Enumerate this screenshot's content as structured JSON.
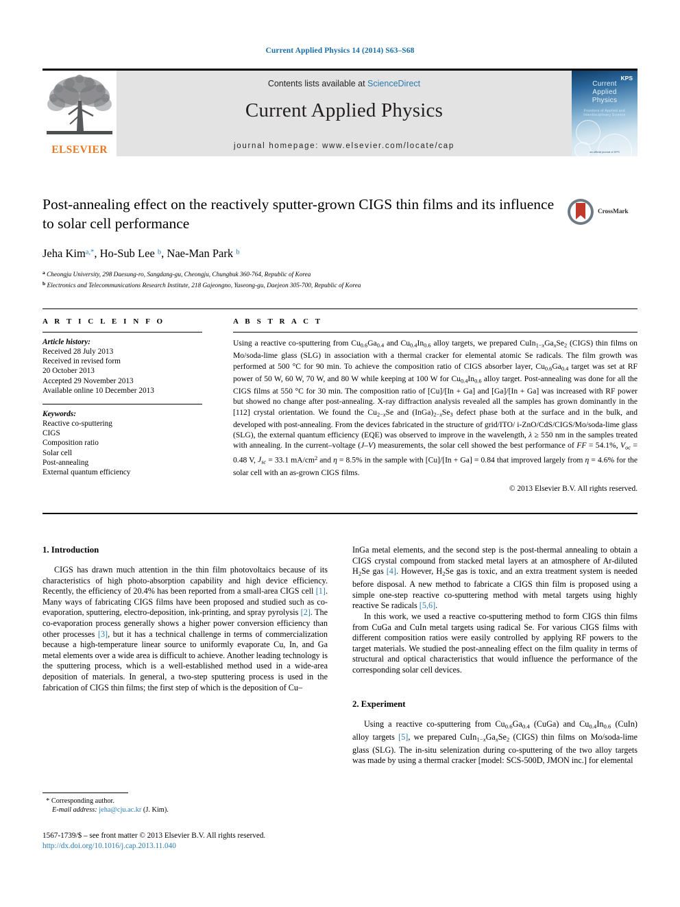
{
  "running_head": "Current Applied Physics 14 (2014) S63–S68",
  "masthead": {
    "publisher": "ELSEVIER",
    "contents_prefix": "Contents lists available at ",
    "contents_link": "ScienceDirect",
    "journal_name": "Current Applied Physics",
    "homepage": "journal homepage: www.elsevier.com/locate/cap",
    "cover": {
      "line1": "Current",
      "line2": "Applied",
      "line3": "Physics",
      "subtitle": "Frontiers of Applied and Interdisciplinary Science",
      "society": "KPS",
      "bottom": "an official journal of KPS"
    }
  },
  "article": {
    "title": "Post-annealing effect on the reactively sputter-grown CIGS thin films and its influence to solar cell performance",
    "crossmark_label": "CrossMark",
    "authors_html": "Jeha Kim<sup>a,*</sup>, Ho-Sub Lee <sup>b</sup>, Nae-Man Park <sup>b</sup>",
    "affiliation_a": "Cheongju University, 298 Daesung-ro, Sangdang-gu, Cheongju, Chungbuk 360-764, Republic of Korea",
    "affiliation_b": "Electronics and Telecommunications Research Institute, 218 Gajeongno, Yuseong-gu, Daejeon 305-700, Republic of Korea"
  },
  "article_info": {
    "heading": "A R T I C L E  I N F O",
    "history_label": "Article history:",
    "history": [
      "Received 28 July 2013",
      "Received in revised form",
      "20 October 2013",
      "Accepted 29 November 2013",
      "Available online 10 December 2013"
    ],
    "keywords_label": "Keywords:",
    "keywords": [
      "Reactive co-sputtering",
      "CIGS",
      "Composition ratio",
      "Solar cell",
      "Post-annealing",
      "External quantum efficiency"
    ]
  },
  "abstract": {
    "heading": "A B S T R A C T",
    "body_html": "Using a reactive co-sputtering from Cu<sub>0.6</sub>Ga<sub>0.4</sub> and Cu<sub>0.4</sub>In<sub>0.6</sub> alloy targets, we prepared CuIn<sub>1−<span class=\"ital\">x</span></sub>Ga<sub><span class=\"ital\">x</span></sub>Se<sub>2</sub> (CIGS) thin films on Mo/soda-lime glass (SLG) in association with a thermal cracker for elemental atomic Se radicals. The film growth was performed at 500 °C for 90 min. To achieve the composition ratio of CIGS absorber layer, Cu<sub>0.6</sub>Ga<sub>0.4</sub> target was set at RF power of 50 W, 60 W, 70 W, and 80 W while keeping at 100 W for Cu<sub>0.4</sub>In<sub>0.6</sub> alloy target. Post-annealing was done for all the CIGS films at 550 °C for 30 min. The composition ratio of [Cu]/[In + Ga] and [Ga]/[In + Ga] was increased with RF power but showed no change after post-annealing. X-ray diffraction analysis revealed all the samples has grown dominantly in the [112] crystal orientation. We found the Cu<sub>2−<span class=\"ital\">x</span></sub>Se and (InGa)<sub>2−<span class=\"ital\">x</span></sub>Se<sub>3</sub> defect phase both at the surface and in the bulk, and developed with post-annealing. From the devices fabricated in the structure of grid/ITO/ i-ZnO/CdS/CIGS/Mo/soda-lime glass (SLG), the external quantum efficiency (EQE) was observed to improve in the wavelength, <span class=\"ital\">λ</span> ≥ 550 nm in the samples treated with annealing. In the current–voltage (<span class=\"ital\">J</span>–<span class=\"ital\">V</span>) measurements, the solar cell showed the best performance of <span class=\"ital\">FF</span> = 54.1%, <span class=\"ital\">V<sub>oc</sub></span> = 0.48 V, <span class=\"ital\">J<sub>sc</sub></span> = 33.1 mA/cm<sup>2</sup> and <span class=\"ital\">η</span> = 8.5% in the sample with [Cu]/[In + Ga] = 0.84 that improved largely from <span class=\"ital\">η</span> = 4.6% for the solar cell with an as-grown CIGS films.",
    "copyright": "© 2013 Elsevier B.V. All rights reserved."
  },
  "sections": {
    "intro_heading": "1. Introduction",
    "intro_p1_html": "CIGS has drawn much attention in the thin film photovoltaics because of its characteristics of high photo-absorption capability and high device efficiency. Recently, the efficiency of 20.4% has been reported from a small-area CIGS cell <span class=\"ref\">[1]</span>. Many ways of fabricating CIGS films have been proposed and studied such as co-evaporation, sputtering, electro-deposition, ink-printing, and spray pyrolysis <span class=\"ref\">[2]</span>. The co-evaporation process generally shows a higher power conversion efficiency than other processes <span class=\"ref\">[3]</span>, but it has a technical challenge in terms of commercialization because a high-temperature linear source to uniformly evaporate Cu, In, and Ga metal elements over a wide area is difficult to achieve. Another leading technology is the sputtering process, which is a well-established method used in a wide-area deposition of materials. In general, a two-step sputtering process is used in the fabrication of CIGS thin films; the first step of which is the deposition of Cu–",
    "intro_p2_html": "InGa metal elements, and the second step is the post-thermal annealing to obtain a CIGS crystal compound from stacked metal layers at an atmosphere of Ar-diluted H<sub>2</sub>Se gas <span class=\"ref\">[4]</span>. However, H<sub>2</sub>Se gas is toxic, and an extra treatment system is needed before disposal. A new method to fabricate a CIGS thin film is proposed using a simple one-step reactive co-sputtering method with metal targets using highly reactive Se radicals <span class=\"ref\">[5,6]</span>.",
    "intro_p3_html": "In this work, we used a reactive co-sputtering method to form CIGS thin films from CuGa and CuIn metal targets using radical Se. For various CIGS films with different composition ratios were easily controlled by applying RF powers to the target materials. We studied the post-annealing effect on the film quality in terms of structural and optical characteristics that would influence the performance of the corresponding solar cell devices.",
    "exp_heading": "2. Experiment",
    "exp_p1_html": "Using a reactive co-sputtering from Cu<sub>0.6</sub>Ga<sub>0.4</sub> (CuGa) and Cu<sub>0.4</sub>In<sub>0.6</sub> (CuIn) alloy targets <span class=\"ref\">[5]</span>, we prepared CuIn<sub>1−<span class=\"ital\">x</span></sub>Ga<sub><span class=\"ital\">x</span></sub>Se<sub>2</sub> (CIGS) thin films on Mo/soda-lime glass (SLG). The in-situ selenization during co-sputtering of the two alloy targets was made by using a thermal cracker [model: SCS-500D, JMON inc.] for elemental"
  },
  "footer": {
    "corresponding_marker": "*",
    "corresponding_label": "Corresponding author.",
    "email_label": "E-mail address:",
    "email": "jeha@cju.ac.kr",
    "email_owner": "(J. Kim).",
    "imprint_html": "1567-1739/$ – see front matter © 2013 Elsevier B.V. All rights reserved.",
    "doi": "http://dx.doi.org/10.1016/j.cap.2013.11.040"
  },
  "colors": {
    "link": "#2a7ab0",
    "elsevier_orange": "#E87722",
    "masthead_bg": "#e3e3e3"
  }
}
